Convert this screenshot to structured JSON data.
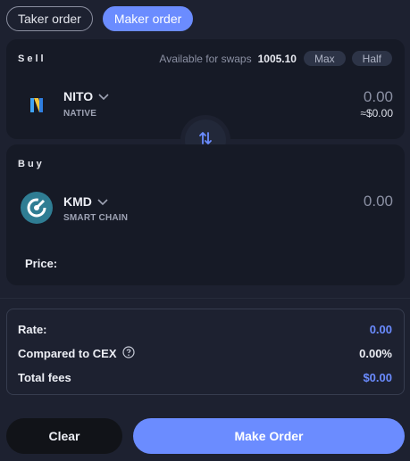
{
  "tabs": [
    {
      "label": "Taker order",
      "active": false
    },
    {
      "label": "Maker order",
      "active": true
    }
  ],
  "sell": {
    "label": "Sell",
    "available_text": "Available for swaps",
    "available_value": "1005.10",
    "max_label": "Max",
    "half_label": "Half",
    "coin": {
      "name": "NITO",
      "sub": "NATIVE",
      "icon": "nito-logo-icon"
    },
    "amount": "0.00",
    "usd": "≈$0.00"
  },
  "buy": {
    "label": "Buy",
    "coin": {
      "name": "KMD",
      "sub": "SMART CHAIN",
      "icon": "kmd-logo-icon"
    },
    "amount": "0.00",
    "price_label": "Price:"
  },
  "info": {
    "rate_label": "Rate:",
    "rate_value": "0.00",
    "cex_label": "Compared to CEX",
    "cex_value": "0.00%",
    "fees_label": "Total fees",
    "fees_value": "$0.00"
  },
  "actions": {
    "clear_label": "Clear",
    "make_label": "Make Order"
  },
  "colors": {
    "accent": "#6b8cff",
    "background": "#1d2130",
    "panel": "#161a26"
  }
}
